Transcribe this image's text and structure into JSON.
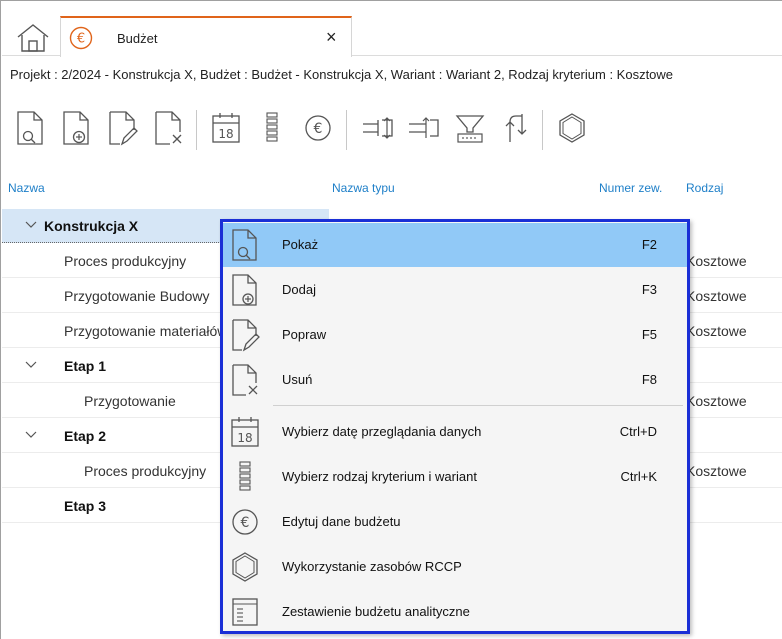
{
  "tab": {
    "title": "Budżet",
    "close": "×"
  },
  "breadcrumb": "Projekt : 2/2024 - Konstrukcja X, Budżet : Budżet - Konstrukcja X, Wariant : Wariant 2, Rodzaj kryterium : Kosztowe",
  "toolbar": {
    "items": [
      "view-icon",
      "add-icon",
      "edit-icon",
      "delete-icon",
      "calendar-icon",
      "criteria-icon",
      "budget-euro-icon",
      "move-in-icon",
      "move-out-icon",
      "filter-icon",
      "reload-icon",
      "rccp-hexagon-icon"
    ],
    "calendar_day": "18"
  },
  "columns": {
    "name": "Nazwa",
    "type_name": "Nazwa typu",
    "ext_number": "Numer zew.",
    "kind": "Rodzaj"
  },
  "tree": {
    "rows": [
      {
        "label": "Konstrukcja X",
        "type": ""
      },
      {
        "label": "Proces produkcyjny",
        "type": "Kosztowe"
      },
      {
        "label": "Przygotowanie Budowy",
        "type": "Kosztowe"
      },
      {
        "label": "Przygotowanie materiałów",
        "type": "Kosztowe"
      },
      {
        "label": "Etap 1",
        "type": ""
      },
      {
        "label": "Przygotowanie",
        "type": "Kosztowe"
      },
      {
        "label": "Etap 2",
        "type": ""
      },
      {
        "label": "Proces produkcyjny",
        "type": "Kosztowe"
      },
      {
        "label": "Etap 3",
        "type": ""
      }
    ]
  },
  "menu": {
    "items": [
      {
        "label": "Pokaż",
        "shortcut": "F2"
      },
      {
        "label": "Dodaj",
        "shortcut": "F3"
      },
      {
        "label": "Popraw",
        "shortcut": "F5"
      },
      {
        "label": "Usuń",
        "shortcut": "F8"
      },
      {
        "label": "Wybierz datę przeglądania danych",
        "shortcut": "Ctrl+D"
      },
      {
        "label": "Wybierz rodzaj kryterium i wariant",
        "shortcut": "Ctrl+K"
      },
      {
        "label": "Edytuj dane budżetu",
        "shortcut": ""
      },
      {
        "label": "Wykorzystanie zasobów RCCP",
        "shortcut": ""
      },
      {
        "label": "Zestawienie budżetu analityczne",
        "shortcut": ""
      }
    ]
  },
  "colors": {
    "accent_tab": "#e0641a",
    "header_blue": "#1e7fc8",
    "menu_highlight": "#91c9f7",
    "menu_border": "#1a2fd6",
    "selected_row": "#d6e6f6"
  }
}
